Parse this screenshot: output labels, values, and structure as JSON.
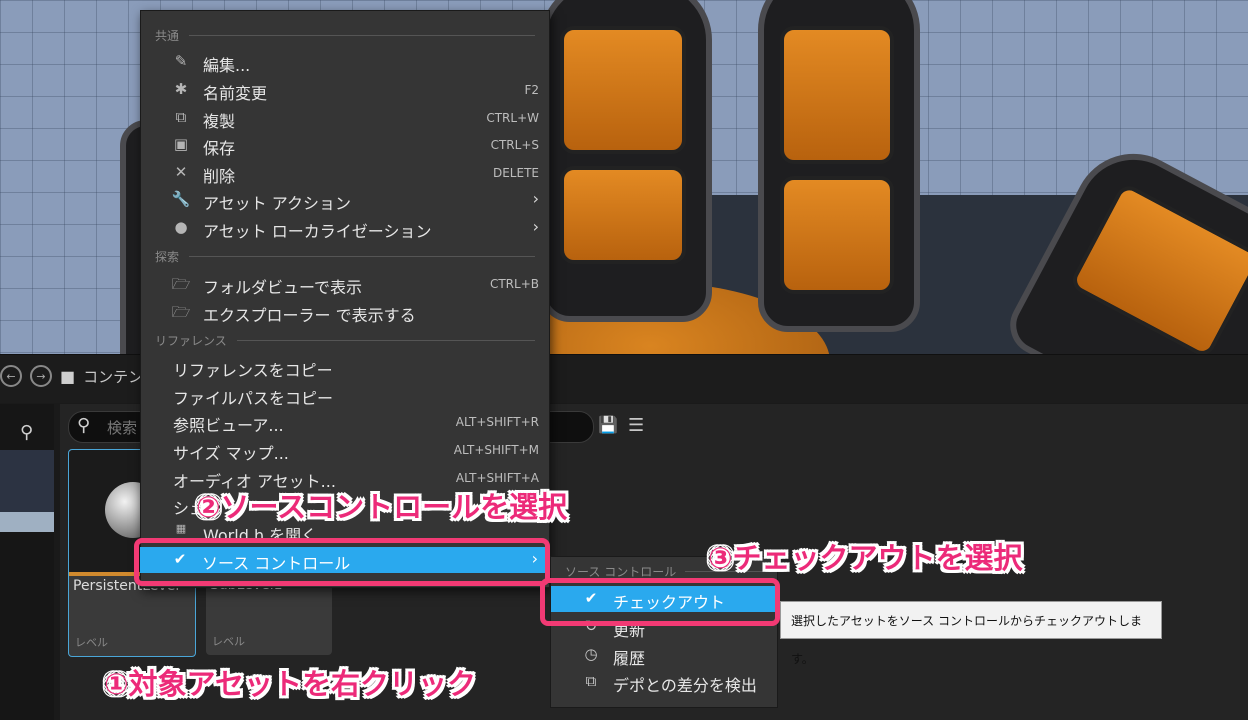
{
  "content_browser": {
    "breadcrumb": "コンテンツ",
    "search_placeholder": "検索",
    "assets": [
      {
        "name": "PersistentLevel",
        "type": "レベル"
      },
      {
        "name": "SubLevel1",
        "type": "レベル"
      }
    ]
  },
  "context_menu": {
    "sections": {
      "common": "共通",
      "explore": "探索",
      "references": "リファレンス"
    },
    "items": [
      {
        "label": "編集...",
        "shortcut": "",
        "icon": "edit-icon"
      },
      {
        "label": "名前変更",
        "shortcut": "F2",
        "icon": "rename-icon"
      },
      {
        "label": "複製",
        "shortcut": "CTRL+W",
        "icon": "duplicate-icon"
      },
      {
        "label": "保存",
        "shortcut": "CTRL+S",
        "icon": "save-icon"
      },
      {
        "label": "削除",
        "shortcut": "DELETE",
        "icon": "delete-icon"
      },
      {
        "label": "アセット アクション",
        "shortcut": "",
        "icon": "wrench-icon"
      },
      {
        "label": "アセット ローカライゼーション",
        "shortcut": "",
        "icon": "globe-icon"
      },
      {
        "label": "フォルダビューで表示",
        "shortcut": "CTRL+B",
        "icon": "folder-search-icon"
      },
      {
        "label": "エクスプローラー で表示する",
        "shortcut": "",
        "icon": "folder-search-icon"
      },
      {
        "label": "リファレンスをコピー",
        "shortcut": ""
      },
      {
        "label": "ファイルパスをコピー",
        "shortcut": ""
      },
      {
        "label": "参照ビューア...",
        "shortcut": "ALT+SHIFT+R"
      },
      {
        "label": "サイズ マップ...",
        "shortcut": "ALT+SHIFT+M"
      },
      {
        "label": "オーディオ アセット...",
        "shortcut": "ALT+SHIFT+A"
      },
      {
        "label": "シェ",
        "shortcut": ""
      },
      {
        "label": "World.h を開く",
        "shortcut": ""
      },
      {
        "label": "ソース コントロール",
        "shortcut": "",
        "icon": "source-control-icon"
      }
    ]
  },
  "submenu": {
    "header": "ソース コントロール",
    "items": [
      {
        "label": "チェックアウト",
        "icon": "checkmark-icon"
      },
      {
        "label": "更新",
        "icon": "refresh-icon"
      },
      {
        "label": "履歴",
        "icon": "history-icon"
      },
      {
        "label": "デポとの差分を検出",
        "icon": "diff-icon"
      }
    ]
  },
  "tooltip": "選択したアセットをソース コントロールからチェックアウトします。",
  "annotations": {
    "step1": "①対象アセットを右クリック",
    "step2": "②ソースコントロールを選択",
    "step3": "③チェックアウトを選択"
  },
  "colors": {
    "highlight": "#2aa9ee",
    "annotation": "#ec2a79",
    "menu_bg": "#353535"
  }
}
